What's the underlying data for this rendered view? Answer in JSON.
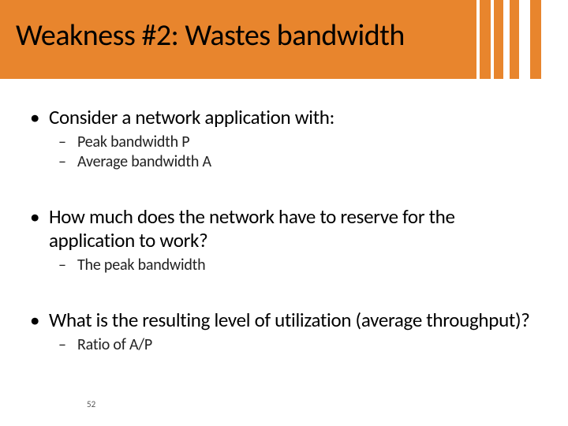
{
  "title": "Weakness #2: Wastes bandwidth",
  "page_number": "52",
  "groups": [
    {
      "lead": "Consider a network application with:",
      "subs": [
        "Peak bandwidth P",
        "Average bandwidth A"
      ]
    },
    {
      "lead": "How much does the network have to reserve for the application to work?",
      "subs": [
        "The peak bandwidth"
      ]
    },
    {
      "lead": "What is the resulting level of utilization (average throughput)?",
      "subs": [
        "Ratio of A/P"
      ]
    }
  ]
}
